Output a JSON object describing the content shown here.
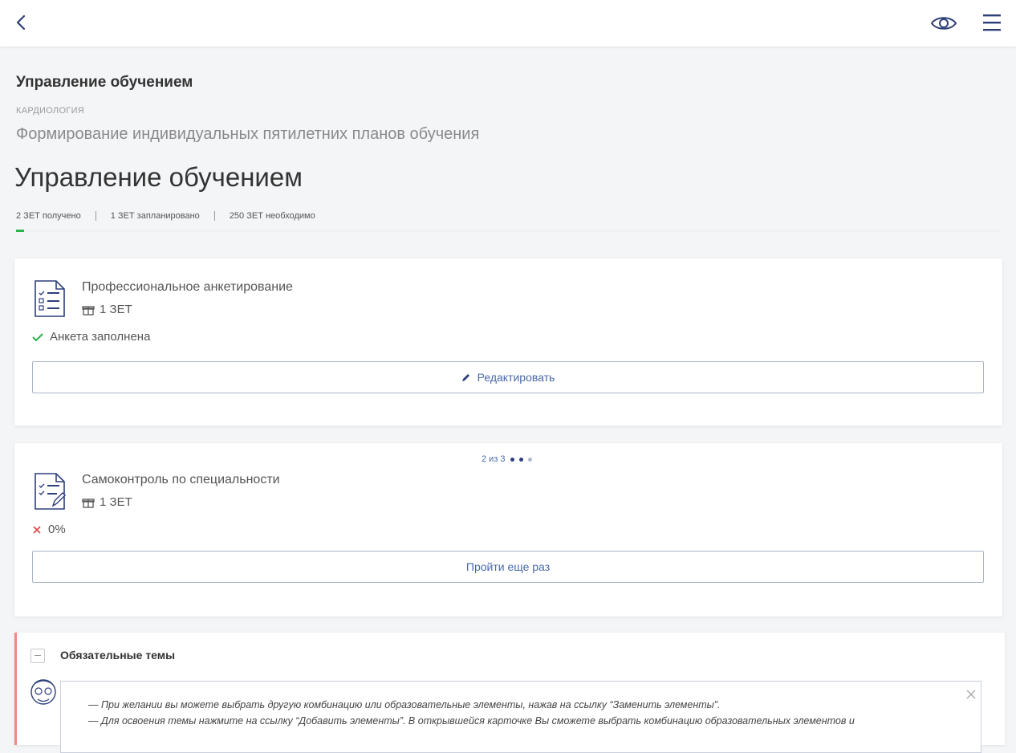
{
  "header": {
    "back_icon": "chevron-left-icon",
    "view_icon": "eye-icon",
    "menu_icon": "hamburger-menu-icon",
    "accent_color": "#2d3f7a"
  },
  "page": {
    "heading": "Управление обучением",
    "specialty": "КАРДИОЛОГИЯ",
    "subtitle": "Формирование индивидуальных пятилетних планов обучения",
    "title": "Управление обучением"
  },
  "stats": {
    "received": "2 ЗЕТ получено",
    "planned": "1 ЗЕТ запланировано",
    "required": "250 ЗЕТ необходимо",
    "progress_fraction": 0.008,
    "progress_color": "#2ab24b"
  },
  "cards": [
    {
      "title": "Профессиональное анкетирование",
      "zet": "1 ЗЕТ",
      "status": "Анкета заполнена",
      "status_icon": "check-icon",
      "action_label": "Редактировать",
      "action_icon": "pencil-icon"
    },
    {
      "pager_text": "2 из 3",
      "title": "Самоконтроль по специальности",
      "zet": "1 ЗЕТ",
      "status": "0%",
      "status_icon": "cross-icon",
      "action_label": "Пройти еще раз"
    }
  ],
  "topics": {
    "title": "Обязательные темы",
    "hint_lines": [
      "—  При желании вы можете выбрать другую комбинацию или образовательные элементы, нажав на ссылку “Заменить элементы”.",
      "—  Для освоения темы нажмите на ссылку “Добавить элементы”. В открывшейся карточке Вы сможете выбрать комбинацию образовательных элементов и"
    ]
  }
}
